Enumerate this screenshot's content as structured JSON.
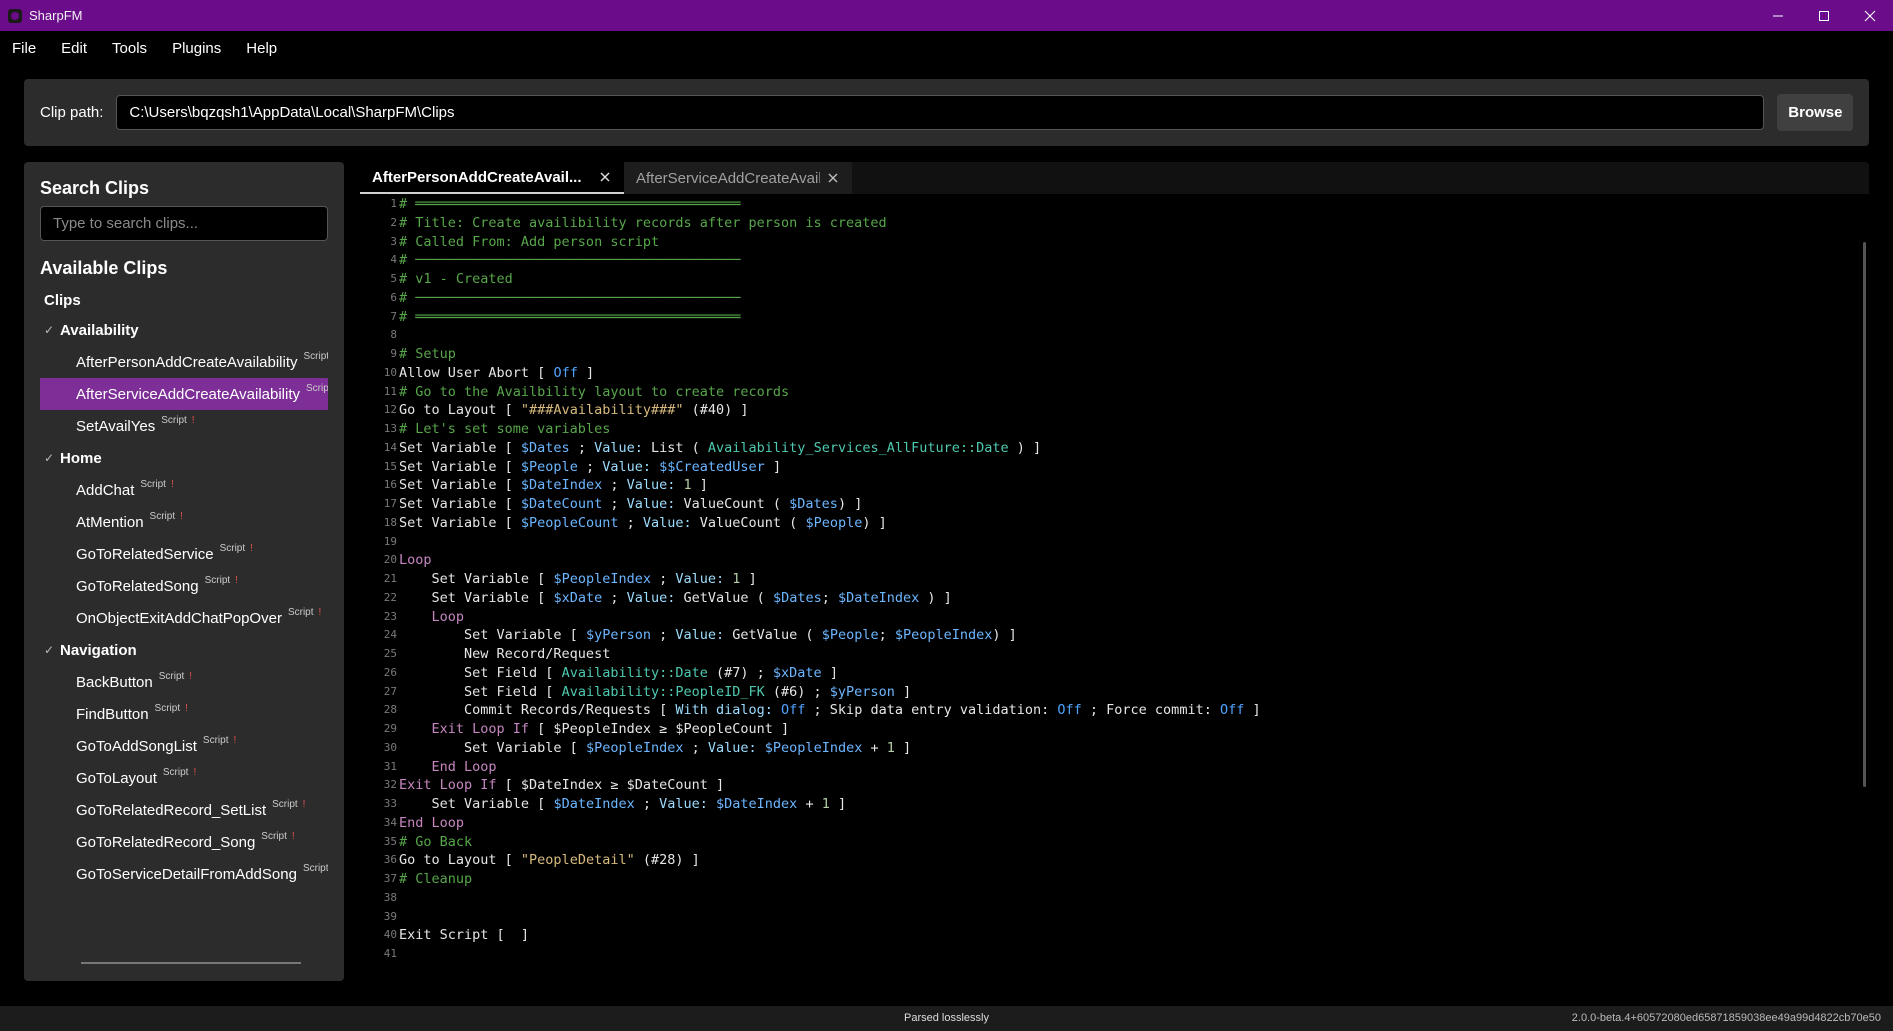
{
  "window": {
    "title": "SharpFM"
  },
  "menu": [
    "File",
    "Edit",
    "Tools",
    "Plugins",
    "Help"
  ],
  "clip_path": {
    "label": "Clip path:",
    "value": "C:\\Users\\bqzqsh1\\AppData\\Local\\SharpFM\\Clips",
    "browse_label": "Browse"
  },
  "sidebar": {
    "search_title": "Search Clips",
    "search_placeholder": "Type to search clips...",
    "available_title": "Available Clips",
    "root": "Clips",
    "tree": [
      {
        "type": "folder",
        "label": "Availability"
      },
      {
        "type": "leaf",
        "label": "AfterPersonAddCreateAvailability",
        "tag": "Script",
        "warn": ""
      },
      {
        "type": "leaf",
        "label": "AfterServiceAddCreateAvailability",
        "tag": "Script",
        "warn": "",
        "selected": true
      },
      {
        "type": "leaf",
        "label": "SetAvailYes",
        "tag": "Script",
        "warn": "!"
      },
      {
        "type": "folder",
        "label": "Home"
      },
      {
        "type": "leaf",
        "label": "AddChat",
        "tag": "Script",
        "warn": "!"
      },
      {
        "type": "leaf",
        "label": "AtMention",
        "tag": "Script",
        "warn": "!"
      },
      {
        "type": "leaf",
        "label": "GoToRelatedService",
        "tag": "Script",
        "warn": "!"
      },
      {
        "type": "leaf",
        "label": "GoToRelatedSong",
        "tag": "Script",
        "warn": "!"
      },
      {
        "type": "leaf",
        "label": "OnObjectExitAddChatPopOver",
        "tag": "Script",
        "warn": "!"
      },
      {
        "type": "folder",
        "label": "Navigation"
      },
      {
        "type": "leaf",
        "label": "BackButton",
        "tag": "Script",
        "warn": "!"
      },
      {
        "type": "leaf",
        "label": "FindButton",
        "tag": "Script",
        "warn": "!"
      },
      {
        "type": "leaf",
        "label": "GoToAddSongList",
        "tag": "Script",
        "warn": "!"
      },
      {
        "type": "leaf",
        "label": "GoToLayout",
        "tag": "Script",
        "warn": "!"
      },
      {
        "type": "leaf",
        "label": "GoToRelatedRecord_SetList",
        "tag": "Script",
        "warn": "!"
      },
      {
        "type": "leaf",
        "label": "GoToRelatedRecord_Song",
        "tag": "Script",
        "warn": "!"
      },
      {
        "type": "leaf",
        "label": "GoToServiceDetailFromAddSong",
        "tag": "Script",
        "warn": ""
      }
    ]
  },
  "tabs": [
    {
      "label": "AfterPersonAddCreateAvail...",
      "active": true
    },
    {
      "label": "AfterServiceAddCreateAvail...",
      "active": false
    }
  ],
  "code_lines": [
    [
      [
        "c-comment",
        "# ════════════════════════════════════════"
      ]
    ],
    [
      [
        "c-comment",
        "# Title: Create availibility records after person is created"
      ]
    ],
    [
      [
        "c-comment",
        "# Called From: Add person script"
      ]
    ],
    [
      [
        "c-comment",
        "# ────────────────────────────────────────"
      ]
    ],
    [
      [
        "c-comment",
        "# v1 - Created"
      ]
    ],
    [
      [
        "c-comment",
        "# ────────────────────────────────────────"
      ]
    ],
    [
      [
        "c-comment",
        "# ════════════════════════════════════════"
      ]
    ],
    [],
    [
      [
        "c-comment",
        "# Setup"
      ]
    ],
    [
      [
        "c-kw",
        "Allow User Abort [ "
      ],
      [
        "c-bool",
        "Off"
      ],
      [
        "c-kw",
        " ]"
      ]
    ],
    [
      [
        "c-comment",
        "# Go to the Availbility layout to create records"
      ]
    ],
    [
      [
        "c-kw",
        "Go to Layout [ "
      ],
      [
        "c-str",
        "\"###Availability###\""
      ],
      [
        "c-kw",
        " (#40) ]"
      ]
    ],
    [
      [
        "c-comment",
        "# Let's set some variables"
      ]
    ],
    [
      [
        "c-kw",
        "Set Variable [ "
      ],
      [
        "c-var",
        "$Dates"
      ],
      [
        "c-kw",
        " ; "
      ],
      [
        "c-param",
        "Value:"
      ],
      [
        "c-kw",
        " List ( "
      ],
      [
        "c-field",
        "Availability_Services_AllFuture::Date"
      ],
      [
        "c-kw",
        " ) ]"
      ]
    ],
    [
      [
        "c-kw",
        "Set Variable [ "
      ],
      [
        "c-var",
        "$People"
      ],
      [
        "c-kw",
        " ; "
      ],
      [
        "c-param",
        "Value:"
      ],
      [
        "c-kw",
        " "
      ],
      [
        "c-var",
        "$$CreatedUser"
      ],
      [
        "c-kw",
        " ]"
      ]
    ],
    [
      [
        "c-kw",
        "Set Variable [ "
      ],
      [
        "c-var",
        "$DateIndex"
      ],
      [
        "c-kw",
        " ; "
      ],
      [
        "c-param",
        "Value:"
      ],
      [
        "c-kw",
        " "
      ],
      [
        "c-num",
        "1"
      ],
      [
        "c-kw",
        " ]"
      ]
    ],
    [
      [
        "c-kw",
        "Set Variable [ "
      ],
      [
        "c-var",
        "$DateCount"
      ],
      [
        "c-kw",
        " ; "
      ],
      [
        "c-param",
        "Value:"
      ],
      [
        "c-kw",
        " ValueCount ( "
      ],
      [
        "c-var",
        "$Dates"
      ],
      [
        "c-kw",
        ") ]"
      ]
    ],
    [
      [
        "c-kw",
        "Set Variable [ "
      ],
      [
        "c-var",
        "$PeopleCount"
      ],
      [
        "c-kw",
        " ; "
      ],
      [
        "c-param",
        "Value:"
      ],
      [
        "c-kw",
        " ValueCount ( "
      ],
      [
        "c-var",
        "$People"
      ],
      [
        "c-kw",
        ") ]"
      ]
    ],
    [],
    [
      [
        "c-loop",
        "Loop"
      ]
    ],
    [
      [
        "c-kw",
        "    Set Variable [ "
      ],
      [
        "c-var",
        "$PeopleIndex"
      ],
      [
        "c-kw",
        " ; "
      ],
      [
        "c-param",
        "Value:"
      ],
      [
        "c-kw",
        " "
      ],
      [
        "c-num",
        "1"
      ],
      [
        "c-kw",
        " ]"
      ]
    ],
    [
      [
        "c-kw",
        "    Set Variable [ "
      ],
      [
        "c-var",
        "$xDate"
      ],
      [
        "c-kw",
        " ; "
      ],
      [
        "c-param",
        "Value:"
      ],
      [
        "c-kw",
        " GetValue ( "
      ],
      [
        "c-var",
        "$Dates"
      ],
      [
        "c-kw",
        "; "
      ],
      [
        "c-var",
        "$DateIndex"
      ],
      [
        "c-kw",
        " ) ]"
      ]
    ],
    [
      [
        "c-loop",
        "    Loop"
      ]
    ],
    [
      [
        "c-kw",
        "        Set Variable [ "
      ],
      [
        "c-var",
        "$yPerson"
      ],
      [
        "c-kw",
        " ; "
      ],
      [
        "c-param",
        "Value:"
      ],
      [
        "c-kw",
        " GetValue ( "
      ],
      [
        "c-var",
        "$People"
      ],
      [
        "c-kw",
        "; "
      ],
      [
        "c-var",
        "$PeopleIndex"
      ],
      [
        "c-kw",
        ") ]"
      ]
    ],
    [
      [
        "c-kw",
        "        New Record/Request"
      ]
    ],
    [
      [
        "c-kw",
        "        Set Field [ "
      ],
      [
        "c-field",
        "Availability::Date"
      ],
      [
        "c-kw",
        " (#7) ; "
      ],
      [
        "c-var",
        "$xDate"
      ],
      [
        "c-kw",
        " ]"
      ]
    ],
    [
      [
        "c-kw",
        "        Set Field [ "
      ],
      [
        "c-field",
        "Availability::PeopleID_FK"
      ],
      [
        "c-kw",
        " (#6) ; "
      ],
      [
        "c-var",
        "$yPerson"
      ],
      [
        "c-kw",
        " ]"
      ]
    ],
    [
      [
        "c-kw",
        "        Commit Records/Requests [ "
      ],
      [
        "c-param",
        "With dialog:"
      ],
      [
        "c-kw",
        " "
      ],
      [
        "c-bool",
        "Off"
      ],
      [
        "c-kw",
        " ; Skip data entry validation: "
      ],
      [
        "c-bool",
        "Off"
      ],
      [
        "c-kw",
        " ; Force commit: "
      ],
      [
        "c-bool",
        "Off"
      ],
      [
        "c-kw",
        " ]"
      ]
    ],
    [
      [
        "c-loop",
        "    Exit Loop If"
      ],
      [
        "c-kw",
        " [ $PeopleIndex ≥ $PeopleCount ]"
      ]
    ],
    [
      [
        "c-kw",
        "        Set Variable [ "
      ],
      [
        "c-var",
        "$PeopleIndex"
      ],
      [
        "c-kw",
        " ; "
      ],
      [
        "c-param",
        "Value:"
      ],
      [
        "c-kw",
        " "
      ],
      [
        "c-var",
        "$PeopleIndex"
      ],
      [
        "c-kw",
        " + "
      ],
      [
        "c-num",
        "1"
      ],
      [
        "c-kw",
        " ]"
      ]
    ],
    [
      [
        "c-loop",
        "    End Loop"
      ]
    ],
    [
      [
        "c-loop",
        "Exit Loop If"
      ],
      [
        "c-kw",
        " [ $DateIndex ≥ $DateCount ]"
      ]
    ],
    [
      [
        "c-kw",
        "    Set Variable [ "
      ],
      [
        "c-var",
        "$DateIndex"
      ],
      [
        "c-kw",
        " ; "
      ],
      [
        "c-param",
        "Value:"
      ],
      [
        "c-kw",
        " "
      ],
      [
        "c-var",
        "$DateIndex"
      ],
      [
        "c-kw",
        " + "
      ],
      [
        "c-num",
        "1"
      ],
      [
        "c-kw",
        " ]"
      ]
    ],
    [
      [
        "c-loop",
        "End Loop"
      ]
    ],
    [
      [
        "c-comment",
        "# Go Back"
      ]
    ],
    [
      [
        "c-kw",
        "Go to Layout [ "
      ],
      [
        "c-str",
        "\"PeopleDetail\""
      ],
      [
        "c-kw",
        " (#28) ]"
      ]
    ],
    [
      [
        "c-comment",
        "# Cleanup"
      ]
    ],
    [],
    [],
    [
      [
        "c-kw",
        "Exit Script [  ]"
      ]
    ],
    []
  ],
  "status": {
    "center": "Parsed losslessly",
    "version": "2.0.0-beta.4+60572080ed65871859038ee49a99d4822cb70e50"
  },
  "colors": {
    "titlebar": "#6b0c8a",
    "selected_item": "#7e2f97"
  }
}
